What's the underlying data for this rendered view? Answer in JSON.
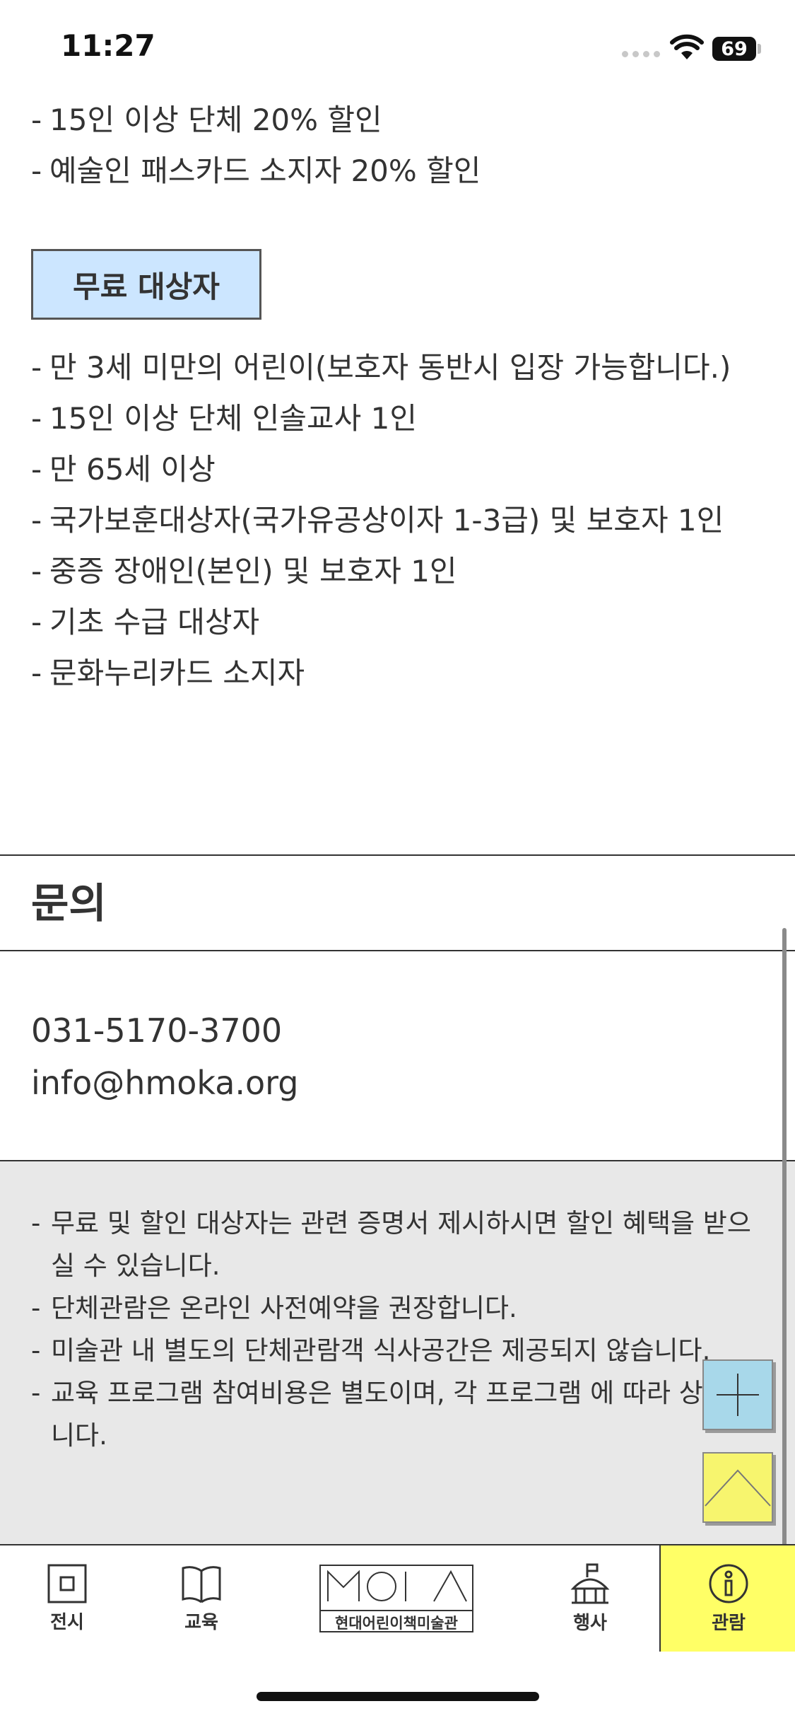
{
  "status_bar": {
    "time": "11:27",
    "battery": "69"
  },
  "discount_items": [
    "15인 이상 단체 20% 할인",
    "예술인 패스카드 소지자 20% 할인"
  ],
  "free_section": {
    "label": "무료 대상자",
    "items": [
      "만 3세 미만의 어린이(보호자 동반시 입장 가능합니다.)",
      "15인 이상 단체 인솔교사 1인",
      "만 65세 이상",
      "국가보훈대상자(국가유공상이자 1-3급) 및 보호자 1인",
      "중증 장애인(본인) 및 보호자 1인",
      "기초 수급 대상자",
      "문화누리카드 소지자"
    ]
  },
  "inquiry": {
    "title": "문의",
    "phone": "031-5170-3700",
    "email": "info@hmoka.org"
  },
  "notices": [
    "무료 및 할인 대상자는 관련 증명서 제시하시면 할인 혜택을 받으실 수 있습니다.",
    "단체관람은 온라인 사전예약을 권장합니다.",
    "미술관 내 별도의 단체관람객 식사공간은 제공되지 않습니다.",
    "교육 프로그램 참여비용은 별도이며, 각 프로그램 에 따라 상이합니다."
  ],
  "tabs": {
    "exhibit": "전시",
    "education": "교육",
    "logo_text": "현대어린이책미술관",
    "event": "행사",
    "visit": "관람"
  },
  "colors": {
    "badge_bg": "#cce6ff",
    "notice_bg": "#e8e8e8",
    "active_tab": "#ffff66",
    "fab_plus": "#a8d8ea",
    "fab_top": "#f7f56e"
  },
  "icons": {
    "exhibit": "square-frame-icon",
    "education": "open-book-icon",
    "event": "tent-flag-icon",
    "visit": "info-circle-icon",
    "fab_plus": "plus-icon",
    "fab_top": "chevron-up-icon"
  }
}
